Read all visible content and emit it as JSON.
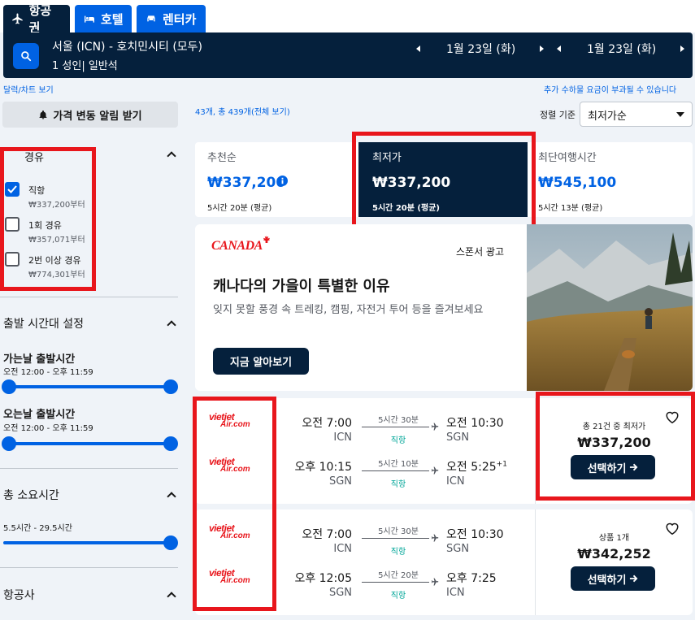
{
  "tabs": [
    {
      "label": "항공권",
      "icon": "airplane-icon"
    },
    {
      "label": "호텔",
      "icon": "bed-icon"
    },
    {
      "label": "렌터카",
      "icon": "car-icon"
    }
  ],
  "search": {
    "route": "서울 (ICN) - 호치민시티 (모두)",
    "passengers": "1 성인| 일반석",
    "depart_date": "1월 23일 (화)",
    "return_date": "1월 23일 (화)"
  },
  "links": {
    "calendar": "달력/차트 보기",
    "fees_notice": "추가 수하물 요금이 부과될 수 있습니다",
    "results_count": "43개, 총 439개(전체 보기)"
  },
  "sidebar": {
    "price_alert": "가격 변동 알림 받기",
    "stops": [
      {
        "label": "직항",
        "sub": "₩337,200부터",
        "checked": true
      },
      {
        "label": "1회 경유",
        "sub": "₩357,071부터",
        "checked": false
      },
      {
        "label": "2번 이상 경유",
        "sub": "₩774,301부터",
        "checked": false
      }
    ],
    "times_title": "출발 시간대 설정",
    "outbound_title": "가는날 출발시간",
    "outbound_range": "오전 12:00 - 오후 11:59",
    "return_title": "오는날 출발시간",
    "return_range": "오전 12:00 - 오후 11:59",
    "duration_title": "총 소요시간",
    "duration_range": "5.5시간 - 29.5시간",
    "airlines_title": "항공사"
  },
  "sort": {
    "label": "정렬 기준",
    "selected": "최저가순",
    "options": [
      {
        "name": "추천순",
        "price": "₩337,200",
        "meta": "5시간 20분 (평균)"
      },
      {
        "name": "최저가",
        "price": "₩337,200",
        "meta": "5시간 20분 (평균)"
      },
      {
        "name": "최단여행시간",
        "price": "₩545,100",
        "meta": "5시간 13분 (평균)"
      }
    ]
  },
  "ad": {
    "brand": "CANADA",
    "sponsor": "스폰서 광고",
    "headline": "캐나다의 가을이 특별한 이유",
    "body": "잊지 못할 풍경 속 트레킹, 캠핑, 자전거 투어 등을 즐겨보세요",
    "cta": "지금 알아보기"
  },
  "airline_logo": {
    "line1": "vietjet",
    "line2": "Air.com"
  },
  "results": [
    {
      "legs": [
        {
          "dep": "오전 7:00",
          "dep_ap": "ICN",
          "dur": "5시간 30분",
          "stops": "직항",
          "arr": "오전 10:30",
          "arr_ap": "SGN",
          "plus": ""
        },
        {
          "dep": "오후 10:15",
          "dep_ap": "SGN",
          "dur": "5시간 10분",
          "stops": "직항",
          "arr": "오전 5:25",
          "arr_ap": "ICN",
          "plus": "+1"
        }
      ],
      "deal": "총 21건 중 최저가",
      "price": "₩337,200",
      "select": "선택하기"
    },
    {
      "legs": [
        {
          "dep": "오전 7:00",
          "dep_ap": "ICN",
          "dur": "5시간 30분",
          "stops": "직항",
          "arr": "오전 10:30",
          "arr_ap": "SGN",
          "plus": ""
        },
        {
          "dep": "오후 12:05",
          "dep_ap": "SGN",
          "dur": "5시간 20분",
          "stops": "직항",
          "arr": "오후 7:25",
          "arr_ap": "ICN",
          "plus": ""
        }
      ],
      "deal": "상품 1개",
      "price": "₩342,252",
      "select": "선택하기"
    }
  ],
  "colors": {
    "navy": "#05203c",
    "blue": "#0062e3",
    "highlight": "#e8161c",
    "direct": "#00a698"
  }
}
